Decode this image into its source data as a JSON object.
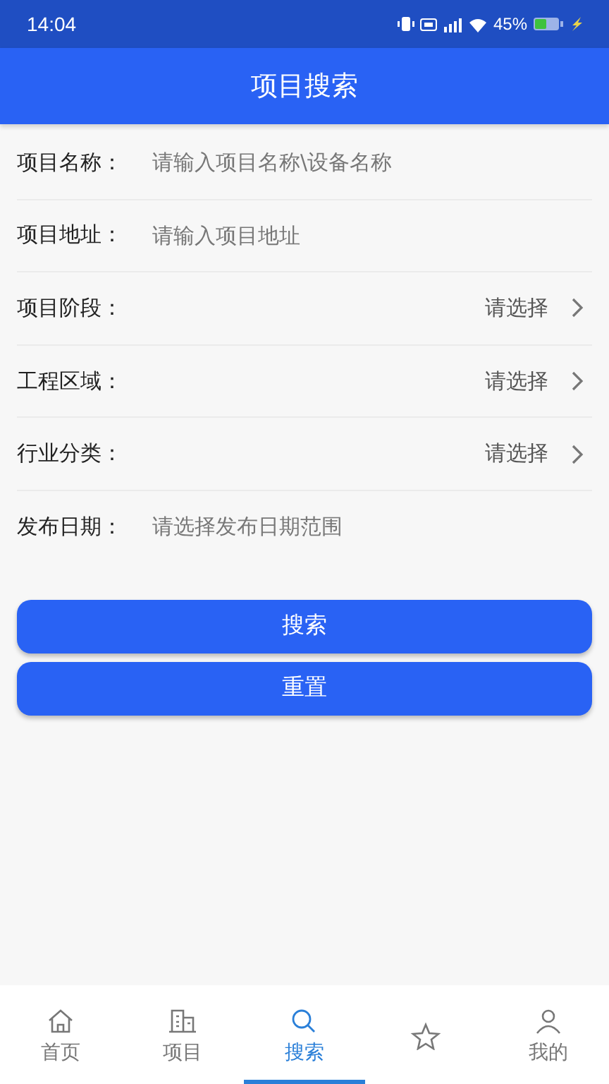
{
  "status_bar": {
    "time": "14:04",
    "battery": "45%"
  },
  "header": {
    "title": "项目搜索"
  },
  "fields": [
    {
      "kind": "input",
      "label": "项目名称：",
      "placeholder": "请输入项目名称\\设备名称"
    },
    {
      "kind": "input",
      "label": "项目地址：",
      "placeholder": "请输入项目地址"
    },
    {
      "kind": "select",
      "label": "项目阶段：",
      "value": "请选择"
    },
    {
      "kind": "select",
      "label": "工程区域：",
      "value": "请选择"
    },
    {
      "kind": "select",
      "label": "行业分类：",
      "value": "请选择"
    },
    {
      "kind": "input",
      "label": "发布日期：",
      "placeholder": "请选择发布日期范围"
    }
  ],
  "buttons": [
    "搜索",
    "重置"
  ],
  "tab_bar": [
    {
      "kind": "home",
      "label": "首页",
      "selected": false
    },
    {
      "kind": "building",
      "label": "项目",
      "selected": false
    },
    {
      "kind": "search",
      "label": "搜索",
      "selected": true
    },
    {
      "kind": "star",
      "selected": false
    },
    {
      "kind": "person",
      "label": "我的",
      "selected": false
    }
  ]
}
